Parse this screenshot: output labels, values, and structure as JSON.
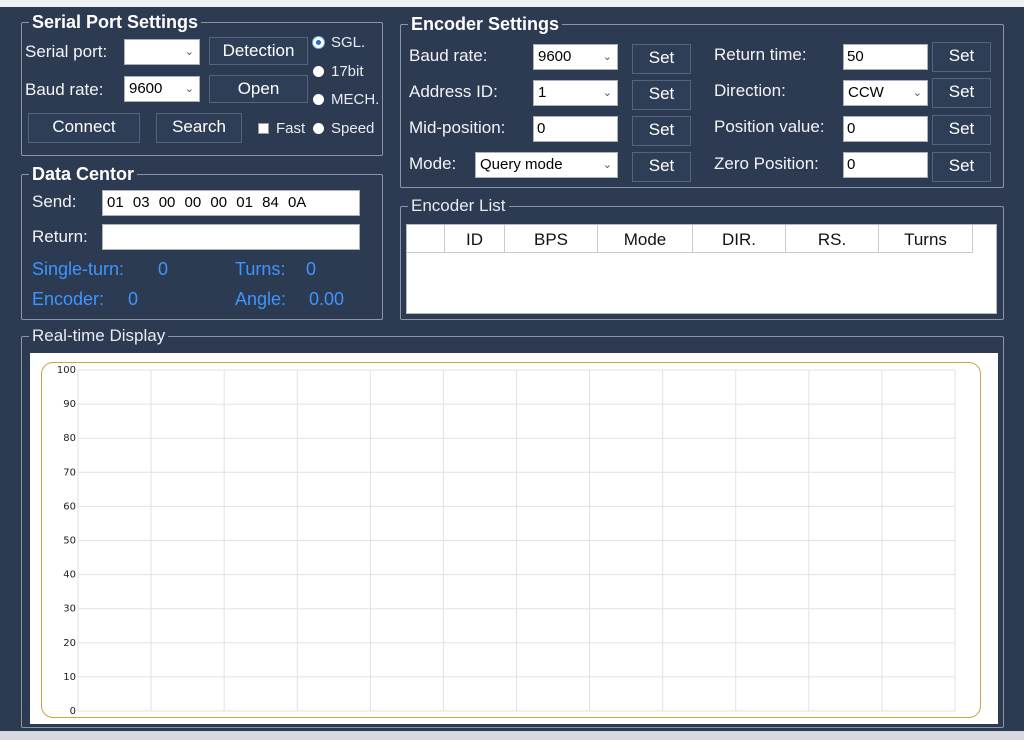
{
  "serial_port_settings": {
    "title": "Serial Port Settings",
    "serial_port_label": "Serial port:",
    "serial_port_value": "",
    "baud_rate_label": "Baud rate:",
    "baud_rate_value": "9600",
    "detection_button": "Detection",
    "open_button": "Open",
    "connect_button": "Connect",
    "search_button": "Search",
    "mode_options": [
      {
        "label": "SGL.",
        "checked": true
      },
      {
        "label": "17bit",
        "checked": false
      },
      {
        "label": "MECH.",
        "checked": false
      }
    ],
    "fast_label": "Fast",
    "fast_checked": false,
    "speed_label": "Speed"
  },
  "data_center": {
    "title": "Data Centor",
    "send_label": "Send:",
    "send_value": "01 03 00 00 00 01 84 0A",
    "return_label": "Return:",
    "return_value": "",
    "single_turn_label": "Single-turn:",
    "single_turn_value": "0",
    "turns_label": "Turns:",
    "turns_value": "0",
    "encoder_label": "Encoder:",
    "encoder_value": "0",
    "angle_label": "Angle:",
    "angle_value": "0.00"
  },
  "encoder_settings": {
    "title": "Encoder Settings",
    "set_label": "Set",
    "baud_rate_label": "Baud rate:",
    "baud_rate_value": "9600",
    "address_id_label": "Address  ID:",
    "address_id_value": "1",
    "mid_position_label": "Mid-position:",
    "mid_position_value": "0",
    "mode_label": "Mode:",
    "mode_value": "Query mode",
    "return_time_label": "Return time:",
    "return_time_value": "50",
    "direction_label": "Direction:",
    "direction_value": "CCW",
    "position_value_label": "Position value:",
    "position_value_value": "0",
    "zero_position_label": "Zero Position:",
    "zero_position_value": "0"
  },
  "encoder_list": {
    "title": "Encoder List",
    "columns": [
      "",
      "ID",
      "BPS",
      "Mode",
      "DIR.",
      "RS.",
      "Turns"
    ]
  },
  "realtime_display": {
    "title": "Real-time Display"
  },
  "chart_data": {
    "type": "line",
    "title": "",
    "xlabel": "",
    "ylabel": "",
    "ylim": [
      0,
      100
    ],
    "y_ticks": [
      "100",
      "90",
      "80",
      "70",
      "60",
      "50",
      "40",
      "30",
      "20",
      "10",
      "0"
    ],
    "x_gridlines": 12,
    "grid": true,
    "series": []
  }
}
